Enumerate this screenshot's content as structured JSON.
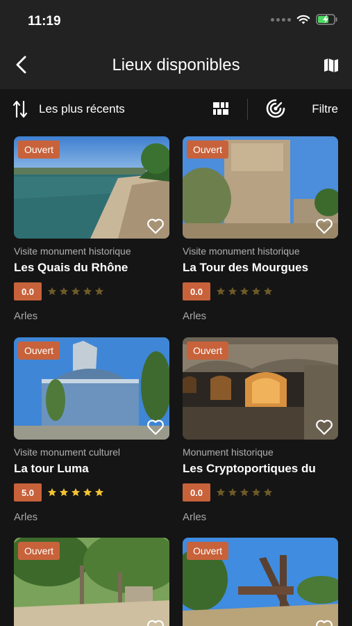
{
  "status": {
    "time": "11:19"
  },
  "nav": {
    "title": "Lieux disponibles"
  },
  "filters": {
    "sort_label": "Les plus récents",
    "filter_label": "Filtre"
  },
  "colors": {
    "accent": "#c8623b",
    "star_on": "#f2c230",
    "star_off": "#6e5a28",
    "background": "#151515",
    "bar": "#222222"
  },
  "places": [
    {
      "badge": "Ouvert",
      "category": "Visite monument historique",
      "name": "Les Quais du Rhône",
      "rating": "0.0",
      "stars_filled": 0,
      "city": "Arles"
    },
    {
      "badge": "Ouvert",
      "category": "Visite monument historique",
      "name": "La Tour des Mourgues",
      "rating": "0.0",
      "stars_filled": 0,
      "city": "Arles"
    },
    {
      "badge": "Ouvert",
      "category": "Visite monument culturel",
      "name": "La tour Luma",
      "rating": "5.0",
      "stars_filled": 5,
      "city": "Arles"
    },
    {
      "badge": "Ouvert",
      "category": "Monument historique",
      "name": "Les Cryptoportiques du",
      "rating": "0.0",
      "stars_filled": 0,
      "city": "Arles"
    },
    {
      "badge": "Ouvert",
      "category": "",
      "name": "",
      "rating": "",
      "stars_filled": 0,
      "city": ""
    },
    {
      "badge": "Ouvert",
      "category": "",
      "name": "",
      "rating": "",
      "stars_filled": 0,
      "city": ""
    }
  ]
}
